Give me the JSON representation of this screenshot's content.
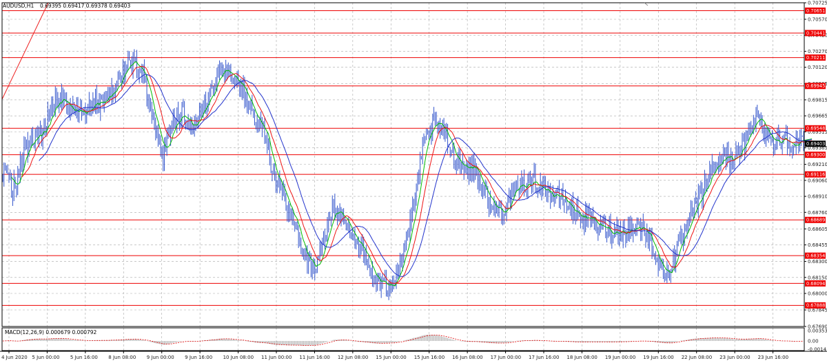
{
  "header": {
    "symbol": "AUDUSD,H1",
    "quote": "0.69395 0.69417 0.69378 0.69403"
  },
  "macd": {
    "label": "MACD(12,26,9) 0.000679 0.000792",
    "ticks": [
      "0.003537",
      "0.00",
      "-0.0014"
    ],
    "line_color": "#dd0000",
    "hist_color": "#b0b0b0"
  },
  "colors": {
    "candle": "#3355cc",
    "ma_fast": "#00bb00",
    "ma_mid": "#ee1111",
    "ma_slow": "#2233cc",
    "level": "#ee0000",
    "trend": "#ee2222",
    "grid": "#a8a8a8",
    "current_bg": "#000000"
  },
  "chart_data": {
    "type": "candlestick",
    "ylim": [
      0.6769,
      0.70725
    ],
    "grid": true,
    "price_ticks": [
      "0.70725",
      "0.70570",
      "0.70420",
      "0.70270",
      "0.70120",
      "0.69965",
      "0.69815",
      "0.69665",
      "0.69515",
      "0.69365",
      "0.69210",
      "0.69060",
      "0.68910",
      "0.68760",
      "0.68605",
      "0.68455",
      "0.68300",
      "0.68150",
      "0.68000",
      "0.67845",
      "0.67690"
    ],
    "levels": [
      "0.70651",
      "0.70441",
      "0.70211",
      "0.69945",
      "0.69548",
      "0.69300",
      "0.69116",
      "0.68689",
      "0.68354",
      "0.68094",
      "0.67888"
    ],
    "current_price": "0.69403",
    "time_labels": [
      "4 Jun 2020",
      "5 Jun 00:00",
      "5 Jun 16:00",
      "8 Jun 08:00",
      "9 Jun 00:00",
      "9 Jun 16:00",
      "10 Jun 08:00",
      "11 Jun 00:00",
      "11 Jun 16:00",
      "12 Jun 08:00",
      "15 Jun 00:00",
      "15 Jun 16:00",
      "16 Jun 08:00",
      "17 Jun 00:00",
      "17 Jun 16:00",
      "18 Jun 08:00",
      "19 Jun 00:00",
      "19 Jun 16:00",
      "22 Jun 08:00",
      "23 Jun 00:00",
      "23 Jun 16:00"
    ],
    "close_path": [
      [
        0,
        0.6912
      ],
      [
        8,
        0.6898
      ],
      [
        16,
        0.6928
      ],
      [
        24,
        0.6945
      ],
      [
        32,
        0.695
      ],
      [
        40,
        0.6978
      ],
      [
        48,
        0.6985
      ],
      [
        56,
        0.6972
      ],
      [
        64,
        0.6965
      ],
      [
        72,
        0.6982
      ],
      [
        80,
        0.6975
      ],
      [
        88,
        0.699
      ],
      [
        96,
        0.701
      ],
      [
        104,
        0.7018
      ],
      [
        112,
        0.7005
      ],
      [
        120,
        0.6965
      ],
      [
        128,
        0.693
      ],
      [
        136,
        0.6965
      ],
      [
        144,
        0.697
      ],
      [
        152,
        0.6955
      ],
      [
        160,
        0.6975
      ],
      [
        168,
        0.6995
      ],
      [
        176,
        0.7012
      ],
      [
        184,
        0.7005
      ],
      [
        192,
        0.699
      ],
      [
        200,
        0.6965
      ],
      [
        208,
        0.695
      ],
      [
        216,
        0.6915
      ],
      [
        224,
        0.689
      ],
      [
        232,
        0.6865
      ],
      [
        240,
        0.684
      ],
      [
        248,
        0.682
      ],
      [
        256,
        0.6848
      ],
      [
        264,
        0.688
      ],
      [
        272,
        0.687
      ],
      [
        280,
        0.6855
      ],
      [
        288,
        0.6835
      ],
      [
        296,
        0.6815
      ],
      [
        304,
        0.6805
      ],
      [
        312,
        0.6815
      ],
      [
        320,
        0.684
      ],
      [
        328,
        0.688
      ],
      [
        336,
        0.694
      ],
      [
        344,
        0.696
      ],
      [
        352,
        0.695
      ],
      [
        360,
        0.693
      ],
      [
        368,
        0.6918
      ],
      [
        376,
        0.692
      ],
      [
        384,
        0.6895
      ],
      [
        392,
        0.6878
      ],
      [
        400,
        0.688
      ],
      [
        408,
        0.6895
      ],
      [
        416,
        0.6902
      ],
      [
        424,
        0.6905
      ],
      [
        432,
        0.6898
      ],
      [
        440,
        0.689
      ],
      [
        448,
        0.6888
      ],
      [
        456,
        0.6875
      ],
      [
        464,
        0.6872
      ],
      [
        472,
        0.6865
      ],
      [
        480,
        0.686
      ],
      [
        488,
        0.6858
      ],
      [
        496,
        0.686
      ],
      [
        504,
        0.6862
      ],
      [
        512,
        0.686
      ],
      [
        520,
        0.684
      ],
      [
        528,
        0.6815
      ],
      [
        536,
        0.6835
      ],
      [
        544,
        0.6855
      ],
      [
        552,
        0.688
      ],
      [
        560,
        0.69
      ],
      [
        568,
        0.692
      ],
      [
        576,
        0.693
      ],
      [
        584,
        0.6925
      ],
      [
        592,
        0.694
      ],
      [
        600,
        0.6968
      ],
      [
        608,
        0.6955
      ],
      [
        616,
        0.694
      ],
      [
        624,
        0.6948
      ],
      [
        632,
        0.694
      ]
    ]
  }
}
